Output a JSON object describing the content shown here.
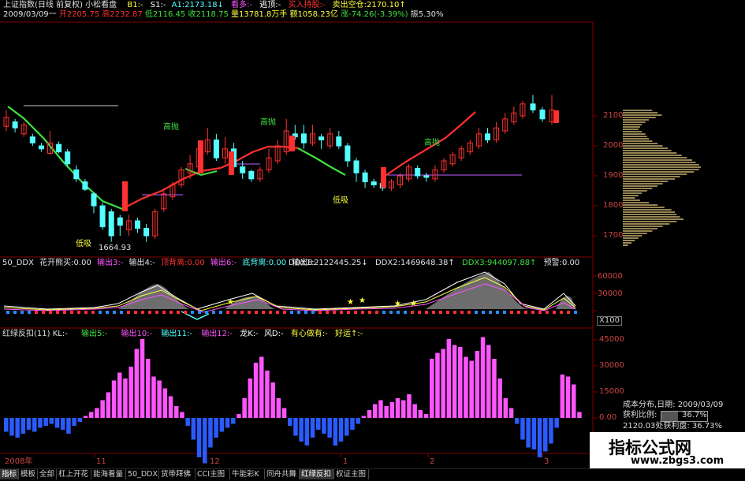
{
  "colors": {
    "up": "#ff3030",
    "down": "#54ffff",
    "magenta": "#ff55ff",
    "blue": "#2a5bff",
    "green": "#40e040",
    "yellow": "#ffff40",
    "grid": "#800000"
  },
  "header": {
    "line1": [
      {
        "text": "上证指数(日线 前复权) 小松看盘",
        "color": "#e0e0e0"
      },
      {
        "text": "B1:-",
        "color": "#ffff40"
      },
      {
        "text": "S1:-",
        "color": "#ffffff"
      },
      {
        "text": "A1:2173.18↓",
        "color": "#54ffff"
      },
      {
        "text": "看多:-",
        "color": "#ff55ff"
      },
      {
        "text": "逃顶:-",
        "color": "#ffffff"
      },
      {
        "text": "买入持股:-",
        "color": "#ff3030"
      },
      {
        "text": "卖出空仓:2170.10↑",
        "color": "#ffff40"
      }
    ],
    "line2": [
      {
        "text": "2009/03/09一",
        "color": "#e0e0e0"
      },
      {
        "text": "开2205.75",
        "color": "#ff3030"
      },
      {
        "text": "高2232.87",
        "color": "#ff3030"
      },
      {
        "text": "低2116.45",
        "color": "#40e040"
      },
      {
        "text": "收2118.75",
        "color": "#40e040"
      },
      {
        "text": "量13781.8万手",
        "color": "#ffff40"
      },
      {
        "text": "额1058.23亿",
        "color": "#ffff40"
      },
      {
        "text": "涨-74.26(-3.39%)",
        "color": "#40e040"
      },
      {
        "text": "振5.30%",
        "color": "#e0e0e0"
      }
    ]
  },
  "annotations": [
    {
      "text": "高抛",
      "color": "#40e040"
    },
    {
      "text": "高抛",
      "color": "#40e040"
    },
    {
      "text": "高抛",
      "color": "#40e040"
    },
    {
      "text": "低吸",
      "color": "#ffff40"
    },
    {
      "text": "低吸",
      "color": "#ffff40"
    },
    {
      "text": "1664.93",
      "color": "#e0e0e0"
    }
  ],
  "main_axis": [
    "2100",
    "2000",
    "1900",
    "1800",
    "1700"
  ],
  "ddx_header": [
    {
      "text": "50_DDX",
      "color": "#e0e0e0"
    },
    {
      "text": "花开熊买:0.00",
      "color": "#e0e0e0"
    },
    {
      "text": "输出3:-",
      "color": "#ff55ff"
    },
    {
      "text": "输出4:-",
      "color": "#e0e0e0"
    },
    {
      "text": "顶背离:0.00",
      "color": "#ff3030"
    },
    {
      "text": "输出6:-",
      "color": "#ff55ff"
    },
    {
      "text": "底背离:0.00",
      "color": "#54ffff"
    },
    {
      "text": "输出8:-",
      "color": "#e0e0e0"
    },
    {
      "text": "DDX1:2122445.25↓",
      "color": "#e0e0e0"
    },
    {
      "text": "DDX2:1469648.38↑",
      "color": "#e0e0e0"
    },
    {
      "text": "DDX3:944097.88↑",
      "color": "#40e040"
    },
    {
      "text": "预警:0.00",
      "color": "#e0e0e0"
    }
  ],
  "ddx_axis": [
    "60000",
    "30000",
    "X100"
  ],
  "hist_header": [
    {
      "text": "红绿反扣(11) KL:-",
      "color": "#e0e0e0"
    },
    {
      "text": "输出5:-",
      "color": "#40e040"
    },
    {
      "text": "输出10:-",
      "color": "#ff55ff"
    },
    {
      "text": "输出11:-",
      "color": "#54ffff"
    },
    {
      "text": "输出12:-",
      "color": "#ff55ff"
    },
    {
      "text": "龙K:-",
      "color": "#ffffff"
    },
    {
      "text": "风D:-",
      "color": "#ffffff"
    },
    {
      "text": "有心做有:-",
      "color": "#ffff40"
    },
    {
      "text": "好运↑:-",
      "color": "#ffff40"
    }
  ],
  "hist_axis": [
    "45000",
    "30000",
    "15000",
    "0.00"
  ],
  "chip_panel": {
    "title": "成本分布,日期: 2009/03/09",
    "profit_label": "获利比例:",
    "profit_value": "36.7%",
    "profit_line": "2120.03处获利盘: 36.73%"
  },
  "time_axis": [
    "2008年",
    "11",
    "12",
    "1",
    "2",
    "3"
  ],
  "tabs": [
    "指标",
    "模板",
    "全部",
    "杠上开花",
    "能海看量",
    "50_DDX",
    "货带拜佛",
    "CCI主图",
    "牛能彩K",
    "同舟共舞",
    "红绿反扣",
    "权证主图"
  ],
  "active_tab": 10,
  "watermark": {
    "title": "指标公式网",
    "url": "www.zbgs3.com"
  },
  "candles": [
    [
      1,
      2065,
      2095,
      2050,
      2120
    ],
    [
      0,
      2080,
      2060,
      2045,
      2090
    ],
    [
      1,
      2040,
      2070,
      2030,
      2080
    ],
    [
      0,
      2030,
      2010,
      2000,
      2040
    ],
    [
      0,
      2000,
      1990,
      1980,
      2010
    ],
    [
      1,
      1975,
      2010,
      1970,
      2050
    ],
    [
      0,
      2005,
      1980,
      1975,
      2015
    ],
    [
      0,
      1980,
      1940,
      1930,
      1990
    ],
    [
      0,
      1920,
      1890,
      1880,
      1935
    ],
    [
      0,
      1880,
      1855,
      1850,
      1890
    ],
    [
      0,
      1840,
      1800,
      1775,
      1845
    ],
    [
      0,
      1800,
      1730,
      1720,
      1810
    ],
    [
      0,
      1780,
      1700,
      1680,
      1790
    ],
    [
      0,
      1760,
      1735,
      1700,
      1770
    ],
    [
      1,
      1720,
      1750,
      1700,
      1770
    ],
    [
      0,
      1750,
      1725,
      1710,
      1760
    ],
    [
      0,
      1725,
      1700,
      1680,
      1740
    ],
    [
      1,
      1700,
      1780,
      1690,
      1790
    ],
    [
      1,
      1790,
      1840,
      1780,
      1850
    ],
    [
      1,
      1830,
      1870,
      1820,
      1880
    ],
    [
      1,
      1870,
      1920,
      1860,
      1930
    ],
    [
      1,
      1910,
      1940,
      1890,
      1970
    ],
    [
      1,
      1930,
      1990,
      1920,
      2000
    ],
    [
      1,
      1980,
      2020,
      1970,
      2060
    ],
    [
      0,
      2020,
      1960,
      1950,
      2040
    ],
    [
      1,
      1960,
      1990,
      1940,
      2030
    ],
    [
      0,
      1990,
      1930,
      1920,
      2010
    ],
    [
      0,
      1930,
      1910,
      1890,
      1950
    ],
    [
      0,
      1915,
      1890,
      1880,
      1920
    ],
    [
      1,
      1890,
      1920,
      1880,
      1930
    ],
    [
      1,
      1920,
      1960,
      1910,
      1990
    ],
    [
      1,
      1950,
      2000,
      1940,
      2020
    ],
    [
      1,
      1980,
      2050,
      1970,
      2090
    ],
    [
      0,
      2040,
      2030,
      2020,
      2070
    ],
    [
      0,
      2040,
      2010,
      1990,
      2070
    ],
    [
      1,
      2010,
      2040,
      2000,
      2070
    ],
    [
      0,
      2030,
      2020,
      1990,
      2040
    ],
    [
      1,
      2000,
      2040,
      1990,
      2060
    ],
    [
      0,
      2030,
      2000,
      1990,
      2050
    ],
    [
      0,
      2000,
      1950,
      1930,
      2010
    ],
    [
      0,
      1950,
      1910,
      1880,
      1960
    ],
    [
      0,
      1910,
      1880,
      1860,
      1920
    ],
    [
      0,
      1880,
      1870,
      1860,
      1890
    ],
    [
      0,
      1875,
      1860,
      1850,
      1880
    ],
    [
      1,
      1860,
      1880,
      1850,
      1890
    ],
    [
      1,
      1870,
      1900,
      1860,
      1910
    ],
    [
      1,
      1890,
      1930,
      1880,
      1940
    ],
    [
      0,
      1925,
      1900,
      1890,
      1935
    ],
    [
      0,
      1900,
      1895,
      1880,
      1910
    ],
    [
      1,
      1890,
      1920,
      1880,
      1935
    ],
    [
      1,
      1920,
      1950,
      1910,
      1960
    ],
    [
      1,
      1940,
      1970,
      1930,
      1980
    ],
    [
      1,
      1960,
      1990,
      1950,
      2000
    ],
    [
      1,
      1980,
      2010,
      1970,
      2020
    ],
    [
      1,
      2000,
      2040,
      1990,
      2060
    ],
    [
      0,
      2040,
      2020,
      2010,
      2060
    ],
    [
      1,
      2020,
      2060,
      2010,
      2080
    ],
    [
      1,
      2050,
      2090,
      2040,
      2110
    ],
    [
      1,
      2080,
      2110,
      2070,
      2130
    ],
    [
      1,
      2100,
      2140,
      2090,
      2150
    ],
    [
      0,
      2140,
      2120,
      2110,
      2170
    ],
    [
      0,
      2120,
      2090,
      2080,
      2130
    ],
    [
      1,
      2080,
      2120,
      2070,
      2170
    ]
  ],
  "chips": [
    34,
    40,
    45,
    38,
    30,
    26,
    22,
    20,
    18,
    22,
    26,
    28,
    30,
    34,
    40,
    46,
    52,
    56,
    62,
    68,
    74,
    80,
    84,
    88,
    90,
    88,
    82,
    74,
    66,
    60,
    52,
    46,
    40,
    34,
    28,
    22,
    18,
    14,
    20,
    30,
    40,
    48,
    56,
    60,
    62,
    66,
    70,
    62,
    54,
    46,
    40,
    34,
    28,
    22,
    18,
    14,
    10,
    6
  ],
  "hist": [
    -14,
    -18,
    -20,
    -16,
    -12,
    -14,
    -10,
    -8,
    -6,
    -10,
    -12,
    -16,
    -8,
    -4,
    2,
    6,
    10,
    18,
    26,
    38,
    46,
    40,
    52,
    70,
    80,
    60,
    42,
    38,
    30,
    22,
    12,
    6,
    -8,
    -22,
    -40,
    -46,
    -30,
    -20,
    -14,
    -10,
    -6,
    4,
    20,
    40,
    56,
    62,
    48,
    36,
    20,
    10,
    -8,
    -18,
    -24,
    -28,
    -20,
    -12,
    -16,
    -20,
    -28,
    -24,
    -18,
    -12,
    -6,
    2,
    8,
    14,
    18,
    12,
    16,
    20,
    18,
    24,
    14,
    8,
    4,
    60,
    66,
    70,
    80,
    74,
    72,
    62,
    58,
    68,
    82,
    74,
    60,
    40,
    20,
    10,
    -6,
    -22,
    -30,
    -32,
    -40,
    -34,
    -26,
    -10,
    44,
    42,
    34,
    6
  ]
}
